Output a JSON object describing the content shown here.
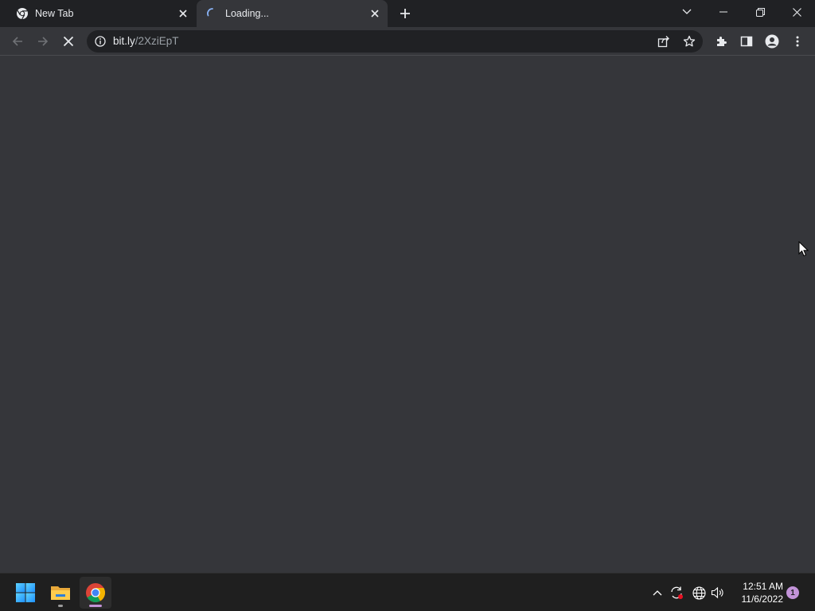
{
  "tabs": [
    {
      "title": "New Tab",
      "icon": "chrome-icon",
      "state": "inactive"
    },
    {
      "title": "Loading...",
      "icon": "loading-spinner-icon",
      "state": "active"
    }
  ],
  "window_controls": [
    "tab-search-icon",
    "minimize-icon",
    "restore-icon",
    "close-icon"
  ],
  "toolbar": {
    "back_icon": "arrow-left-icon",
    "forward_icon": "arrow-right-icon",
    "stop_icon": "stop-icon",
    "url_host": "bit.ly",
    "url_path": "/2XziEpT",
    "omnibox_icons": [
      "share-icon",
      "bookmark-star-icon"
    ],
    "right_icons": [
      "extensions-icon",
      "side-panel-icon",
      "profile-icon",
      "menu-icon"
    ]
  },
  "taskbar": {
    "apps": [
      "windows-start-icon",
      "file-explorer-icon",
      "chrome-icon"
    ],
    "tray_icons": [
      "chevron-up-icon",
      "sync-icon",
      "network-globe-icon",
      "volume-icon"
    ],
    "time": "12:51 AM",
    "date": "11/6/2022",
    "notification_count": "1"
  },
  "colors": {
    "tabstrip_bg": "#202124",
    "toolbar_bg": "#35363a",
    "omnibox_bg": "#202124",
    "taskbar_bg": "#1f1f1f",
    "chrome_indicator": "#c293d8"
  }
}
